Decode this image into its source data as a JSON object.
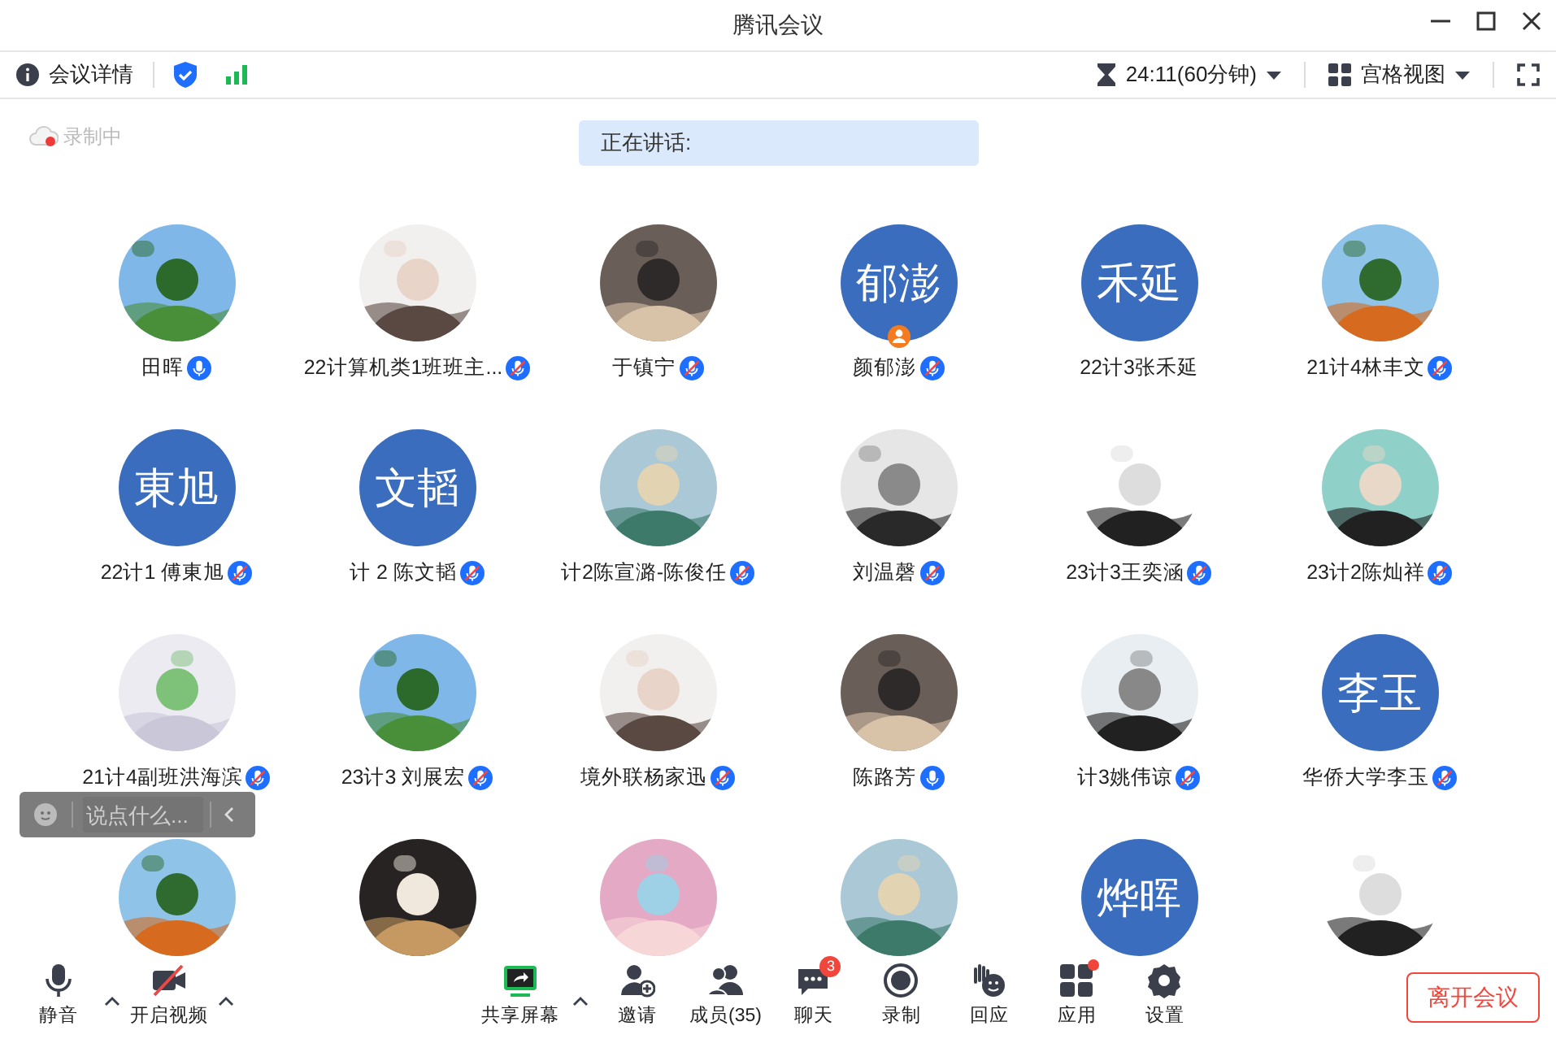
{
  "window": {
    "title": "腾讯会议"
  },
  "toolbar": {
    "details": "会议详情",
    "timer": "24:11(60分钟)",
    "view": "宫格视图"
  },
  "recording": {
    "label": "录制中"
  },
  "speaking": {
    "label": "正在讲话:"
  },
  "participants": [
    {
      "kind": "picture",
      "name": "田晖",
      "muted": false
    },
    {
      "kind": "picture",
      "name": "22计算机类1班班主...",
      "muted": true
    },
    {
      "kind": "picture",
      "name": "于镇宁",
      "muted": true
    },
    {
      "kind": "initials",
      "initials": "郁澎",
      "name": "颜郁澎",
      "muted": true,
      "host": true
    },
    {
      "kind": "initials",
      "initials": "禾延",
      "name": "22计3张禾延"
    },
    {
      "kind": "picture",
      "name": "21计4林丰文",
      "muted": true
    },
    {
      "kind": "initials",
      "initials": "東旭",
      "name": "22计1 傅東旭",
      "muted": true
    },
    {
      "kind": "initials",
      "initials": "文韬",
      "name": "计 2 陈文韬",
      "muted": true
    },
    {
      "kind": "picture",
      "name": "计2陈宣潞-陈俊任",
      "muted": true
    },
    {
      "kind": "picture",
      "name": "刘温磬",
      "muted": true
    },
    {
      "kind": "picture",
      "name": "23计3王奕涵",
      "muted": true
    },
    {
      "kind": "picture",
      "name": "23计2陈灿祥",
      "muted": true
    },
    {
      "kind": "picture",
      "name": "21计4副班洪海滨",
      "muted": true
    },
    {
      "kind": "picture",
      "name": "23计3 刘展宏",
      "muted": true
    },
    {
      "kind": "picture",
      "name": "境外联杨家迅",
      "muted": true
    },
    {
      "kind": "picture",
      "name": "陈路芳",
      "muted": false
    },
    {
      "kind": "picture",
      "name": "计3姚伟谅",
      "muted": true
    },
    {
      "kind": "initials",
      "initials": "李玉",
      "name": "华侨大学李玉",
      "muted": true
    },
    {
      "kind": "picture"
    },
    {
      "kind": "picture"
    },
    {
      "kind": "picture"
    },
    {
      "kind": "picture"
    },
    {
      "kind": "initials",
      "initials": "烨晖"
    },
    {
      "kind": "picture"
    }
  ],
  "chat_input": {
    "placeholder": "说点什么..."
  },
  "tools": [
    {
      "kind": "mic",
      "label": "静音",
      "caret": true
    },
    {
      "kind": "camera_off",
      "label": "开启视频",
      "caret": true
    },
    {
      "kind": "share",
      "label": "共享屏幕",
      "caret": true
    },
    {
      "kind": "invite",
      "label": "邀请"
    },
    {
      "kind": "members",
      "label": "成员(35)"
    },
    {
      "kind": "chat",
      "label": "聊天",
      "badge": "3"
    },
    {
      "kind": "record",
      "label": "录制"
    },
    {
      "kind": "react",
      "label": "回应"
    },
    {
      "kind": "apps",
      "label": "应用",
      "dot": true
    },
    {
      "kind": "settings",
      "label": "设置"
    }
  ],
  "leave_button": "离开会议"
}
